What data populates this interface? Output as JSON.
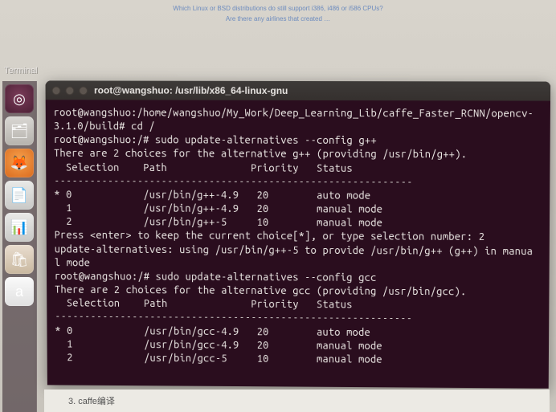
{
  "panel": {
    "label": "Terminal"
  },
  "launcher": {
    "items": [
      {
        "name": "dash-icon",
        "class": "dash",
        "glyph": "◎"
      },
      {
        "name": "files-icon",
        "class": "files",
        "glyph": "🗂"
      },
      {
        "name": "firefox-icon",
        "class": "firefox",
        "glyph": "🦊"
      },
      {
        "name": "document-icon",
        "class": "doc",
        "glyph": "📄"
      },
      {
        "name": "calc-icon",
        "class": "calc",
        "glyph": "📊"
      },
      {
        "name": "software-icon",
        "class": "sw",
        "glyph": "🛍"
      },
      {
        "name": "amazon-icon",
        "class": "amazon",
        "glyph": "a"
      }
    ]
  },
  "terminal": {
    "title": "root@wangshuo: /usr/lib/x86_64-linux-gnu",
    "lines": [
      "root@wangshuo:/home/wangshuo/My_Work/Deep_Learning_Lib/caffe_Faster_RCNN/opencv-",
      "3.1.0/build# cd /",
      "root@wangshuo:/# sudo update-alternatives --config g++",
      "There are 2 choices for the alternative g++ (providing /usr/bin/g++).",
      "",
      "  Selection    Path              Priority   Status",
      "------------------------------------------------------------",
      "* 0            /usr/bin/g++-4.9   20        auto mode",
      "  1            /usr/bin/g++-4.9   20        manual mode",
      "  2            /usr/bin/g++-5     10        manual mode",
      "",
      "Press <enter> to keep the current choice[*], or type selection number: 2",
      "update-alternatives: using /usr/bin/g++-5 to provide /usr/bin/g++ (g++) in manua",
      "l mode",
      "root@wangshuo:/# sudo update-alternatives --config gcc",
      "There are 2 choices for the alternative gcc (providing /usr/bin/gcc).",
      "",
      "  Selection    Path              Priority   Status",
      "------------------------------------------------------------",
      "* 0            /usr/bin/gcc-4.9   20        auto mode",
      "  1            /usr/bin/gcc-4.9   20        manual mode",
      "  2            /usr/bin/gcc-5     10        manual mode"
    ]
  },
  "bottom": {
    "text": "3. caffe编译"
  },
  "bg_hints": {
    "l1": "Which Linux or BSD distributions do still support i386, i486 or i586 CPUs?",
    "l2": "Are there any airlines that created …"
  }
}
